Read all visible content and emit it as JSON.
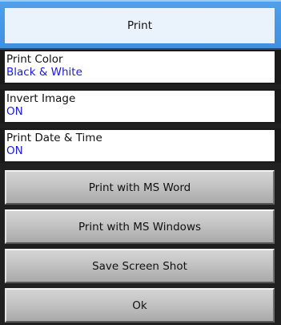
{
  "header": {
    "title": "Print"
  },
  "settings": [
    {
      "label": "Print Color",
      "value": "Black & White"
    },
    {
      "label": "Invert Image",
      "value": "ON"
    },
    {
      "label": "Print Date & Time",
      "value": "ON"
    }
  ],
  "buttons": {
    "ms_word": "Print with MS Word",
    "ms_windows": "Print with MS Windows",
    "screenshot": "Save Screen Shot",
    "ok": "Ok"
  }
}
